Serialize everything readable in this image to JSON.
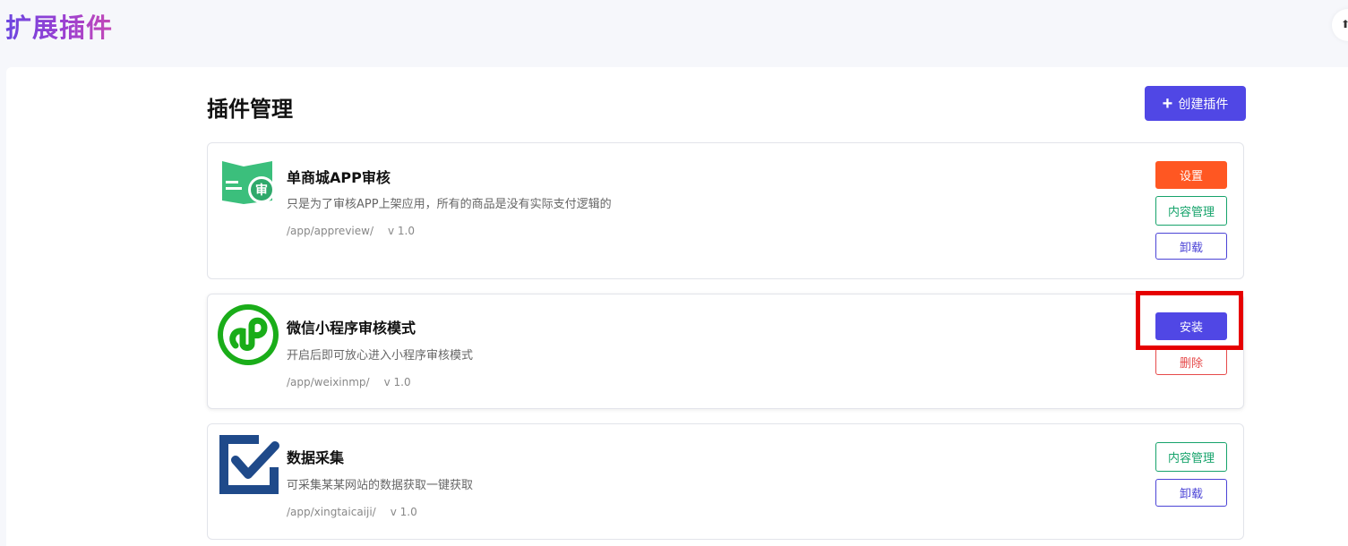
{
  "header": {
    "app_title": "扩展插件",
    "corner_glyph": "⬆"
  },
  "main": {
    "section_title": "插件管理",
    "create_label": "创建插件",
    "create_icon": "plus-icon"
  },
  "plugins": [
    {
      "name": "单商城APP审核",
      "description": "只是为了审核APP上架应用，所有的商品是没有实际支付逻辑的",
      "path": "/app/appreview/",
      "version": "v 1.0",
      "icon": "app-review-icon",
      "icon_glyph": "审",
      "buttons": {
        "settings": "设置",
        "content": "内容管理",
        "uninstall": "卸载"
      }
    },
    {
      "name": "微信小程序审核模式",
      "description": "开启后即可放心进入小程序审核模式",
      "path": "/app/weixinmp/",
      "version": "v 1.0",
      "icon": "wechat-miniprogram-icon",
      "buttons": {
        "install": "安装",
        "delete": "删除"
      }
    },
    {
      "name": "数据采集",
      "description": "可采集某某网站的数据获取一键获取",
      "path": "/app/xingtaicaiji/",
      "version": "v 1.0",
      "icon": "checkmark-box-icon",
      "buttons": {
        "content": "内容管理",
        "uninstall": "卸载"
      }
    }
  ],
  "colors": {
    "primary": "#5047e5",
    "orange": "#ff5722",
    "green": "#16a36b",
    "red": "#e64a4a",
    "highlight": "#e60000"
  }
}
